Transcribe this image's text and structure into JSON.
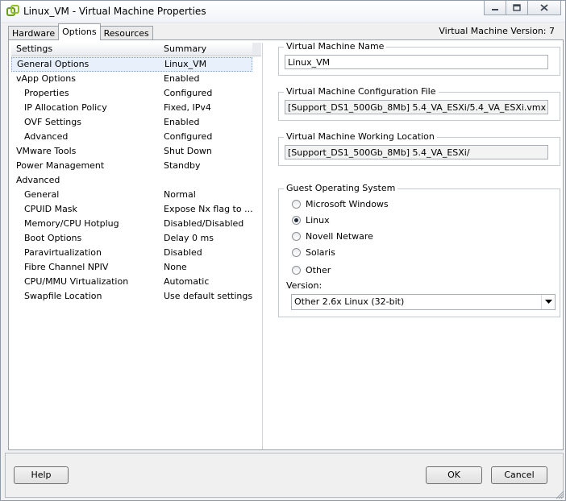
{
  "window": {
    "title": "Linux_VM - Virtual Machine Properties",
    "version_label": "Virtual Machine Version: 7"
  },
  "tabs": [
    {
      "label": "Hardware",
      "active": false
    },
    {
      "label": "Options",
      "active": true
    },
    {
      "label": "Resources",
      "active": false
    }
  ],
  "settings_table": {
    "headers": [
      "Settings",
      "Summary"
    ],
    "rows": [
      {
        "setting": "General Options",
        "summary": "Linux_VM",
        "selected": true,
        "indent": 0
      },
      {
        "setting": "vApp Options",
        "summary": "Enabled",
        "indent": 0
      },
      {
        "setting": "Properties",
        "summary": "Configured",
        "indent": 1
      },
      {
        "setting": "IP Allocation Policy",
        "summary": "Fixed, IPv4",
        "indent": 1
      },
      {
        "setting": "OVF Settings",
        "summary": "Enabled",
        "indent": 1
      },
      {
        "setting": "Advanced",
        "summary": "Configured",
        "indent": 1
      },
      {
        "setting": "VMware Tools",
        "summary": "Shut Down",
        "indent": 0
      },
      {
        "setting": "Power Management",
        "summary": "Standby",
        "indent": 0
      },
      {
        "setting": "Advanced",
        "summary": "",
        "indent": 0
      },
      {
        "setting": "General",
        "summary": "Normal",
        "indent": 1
      },
      {
        "setting": "CPUID Mask",
        "summary": "Expose Nx flag to ...",
        "indent": 1
      },
      {
        "setting": "Memory/CPU Hotplug",
        "summary": "Disabled/Disabled",
        "indent": 1
      },
      {
        "setting": "Boot Options",
        "summary": "Delay 0 ms",
        "indent": 1
      },
      {
        "setting": "Paravirtualization",
        "summary": "Disabled",
        "indent": 1
      },
      {
        "setting": "Fibre Channel NPIV",
        "summary": "None",
        "indent": 1
      },
      {
        "setting": "CPU/MMU Virtualization",
        "summary": "Automatic",
        "indent": 1
      },
      {
        "setting": "Swapfile Location",
        "summary": "Use default settings",
        "indent": 1
      }
    ]
  },
  "vm_name": {
    "label": "Virtual Machine Name",
    "value": "Linux_VM"
  },
  "config_file": {
    "label": "Virtual Machine Configuration File",
    "value": "[Support_DS1_500Gb_8Mb] 5.4_VA_ESXi/5.4_VA_ESXi.vmx"
  },
  "working_location": {
    "label": "Virtual Machine Working Location",
    "value": "[Support_DS1_500Gb_8Mb] 5.4_VA_ESXi/"
  },
  "guest_os": {
    "label": "Guest Operating System",
    "options": [
      {
        "label": "Microsoft Windows",
        "checked": false
      },
      {
        "label": "Linux",
        "checked": true
      },
      {
        "label": "Novell Netware",
        "checked": false
      },
      {
        "label": "Solaris",
        "checked": false
      },
      {
        "label": "Other",
        "checked": false
      }
    ],
    "version_label": "Version:",
    "version_value": "Other 2.6x Linux (32-bit)"
  },
  "buttons": {
    "help": "Help",
    "ok": "OK",
    "cancel": "Cancel"
  }
}
